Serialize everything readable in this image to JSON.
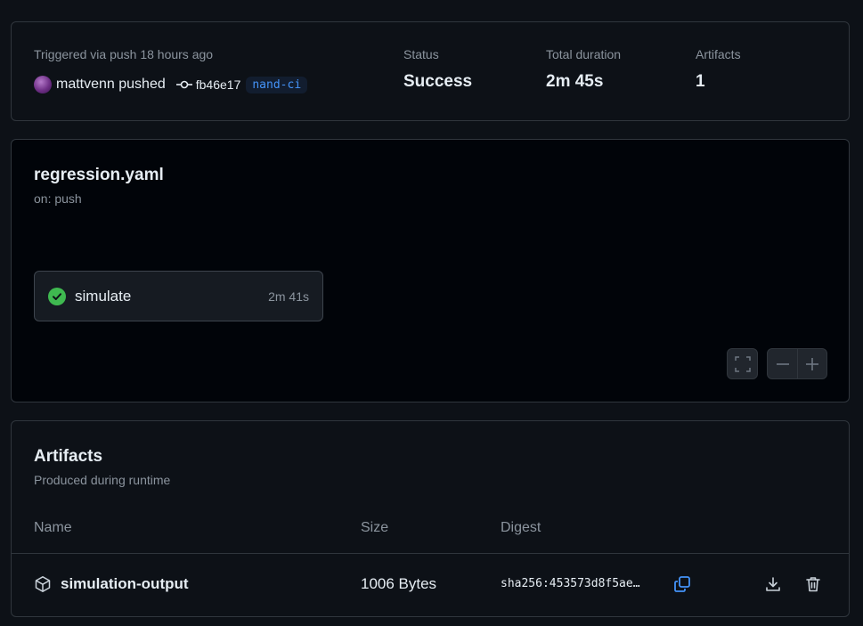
{
  "summary": {
    "trigger_text": "Triggered via push 18 hours ago",
    "pusher": "mattvenn pushed",
    "commit_sha": "fb46e17",
    "branch": "nand-ci",
    "status_label": "Status",
    "status_value": "Success",
    "duration_label": "Total duration",
    "duration_value": "2m 45s",
    "artifacts_label": "Artifacts",
    "artifacts_value": "1"
  },
  "workflow": {
    "file": "regression.yaml",
    "trigger": "on: push",
    "jobs": [
      {
        "name": "simulate",
        "duration": "2m 41s",
        "status": "success",
        "icon": "check-circle-icon"
      }
    ],
    "controls": [
      "fullscreen-icon",
      "zoom-out-icon",
      "zoom-in-icon"
    ]
  },
  "artifacts": {
    "title": "Artifacts",
    "subtitle": "Produced during runtime",
    "columns": {
      "name": "Name",
      "size": "Size",
      "digest": "Digest"
    },
    "rows": [
      {
        "name": "simulation-output",
        "size": "1006 Bytes",
        "digest": "sha256:453573d8f5ae…",
        "icons": [
          "package-icon",
          "copy-icon",
          "download-icon",
          "trash-icon"
        ]
      }
    ]
  },
  "colors": {
    "background": "#0d1117",
    "canvas": "#010409",
    "border": "#30363d",
    "success": "#3fb950",
    "accent": "#4493f8",
    "muted_text": "#8b949e"
  }
}
